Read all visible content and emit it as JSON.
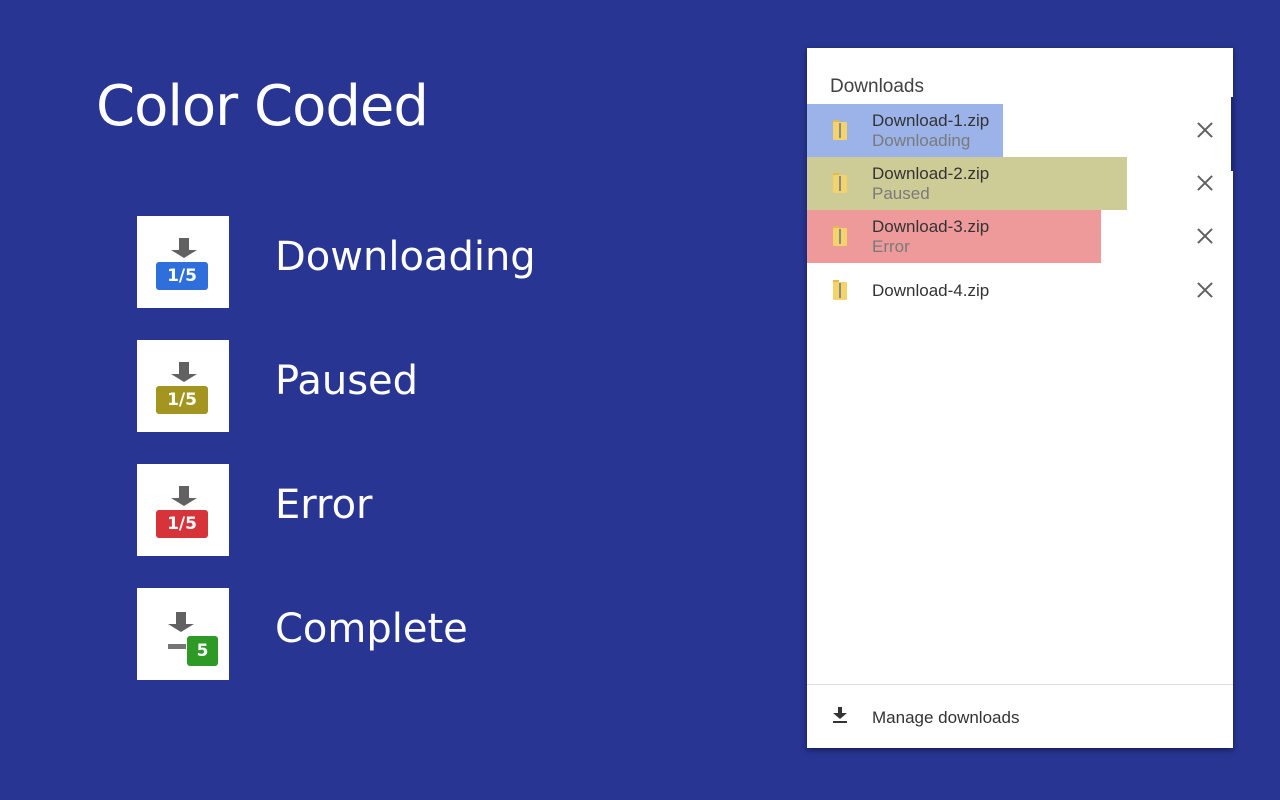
{
  "slide": {
    "title": "Color Coded",
    "legend": [
      {
        "label": "Downloading",
        "badge": "1/5",
        "color": "#2f6fdc"
      },
      {
        "label": "Paused",
        "badge": "1/5",
        "color": "#a39520"
      },
      {
        "label": "Error",
        "badge": "1/5",
        "color": "#d7333a"
      },
      {
        "label": "Complete",
        "badge": "5",
        "color": "#2e9a26"
      }
    ]
  },
  "panel": {
    "title": "Downloads",
    "items": [
      {
        "name": "Download-1.zip",
        "status": "Downloading",
        "progress": 0.46,
        "color": "#9bb3e9"
      },
      {
        "name": "Download-2.zip",
        "status": "Paused",
        "progress": 0.75,
        "color": "#cdcb96"
      },
      {
        "name": "Download-3.zip",
        "status": "Error",
        "progress": 0.69,
        "color": "#ee9a9a"
      },
      {
        "name": "Download-4.zip",
        "status": "",
        "progress": 0,
        "color": "#ffffff"
      }
    ],
    "manage_label": "Manage downloads"
  }
}
